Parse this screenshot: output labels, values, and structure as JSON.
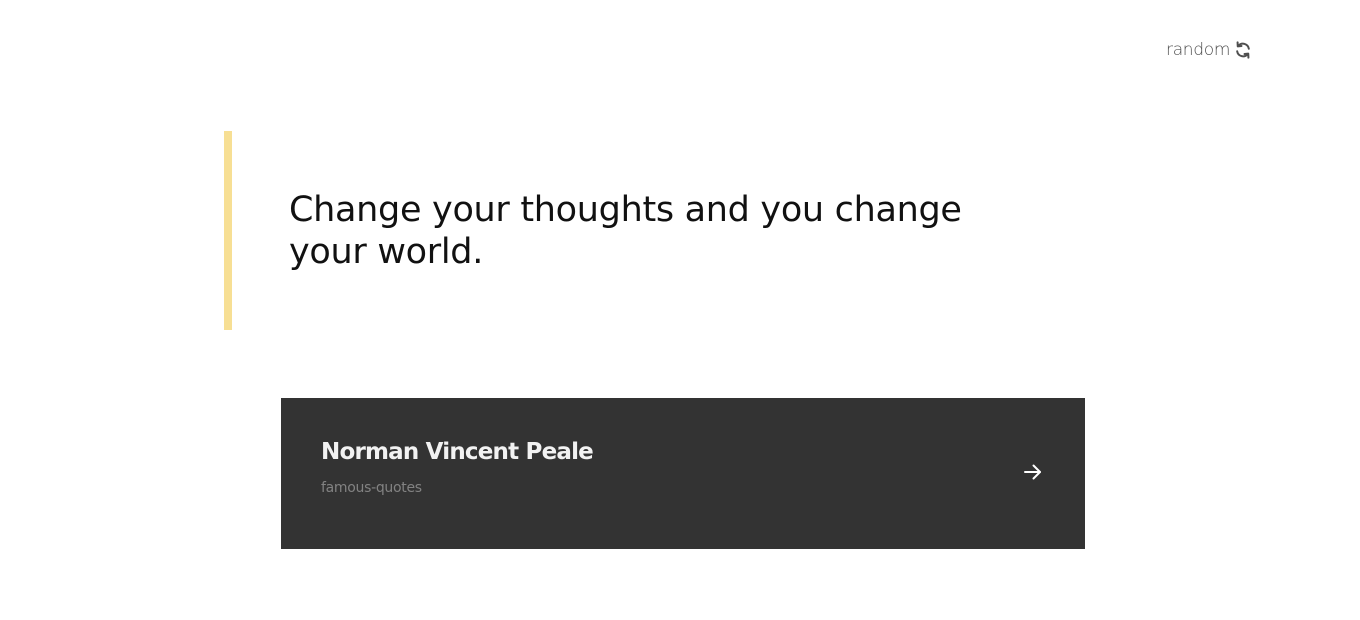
{
  "header": {
    "random_label": "random",
    "random_icon": "refresh-icon"
  },
  "quote": {
    "text": "Change your thoughts and you change your world.",
    "accent_color": "#f7df94"
  },
  "author_card": {
    "name": "Norman Vincent Peale",
    "tag": "famous-quotes",
    "arrow_icon": "arrow-right-icon",
    "background": "#333333"
  }
}
